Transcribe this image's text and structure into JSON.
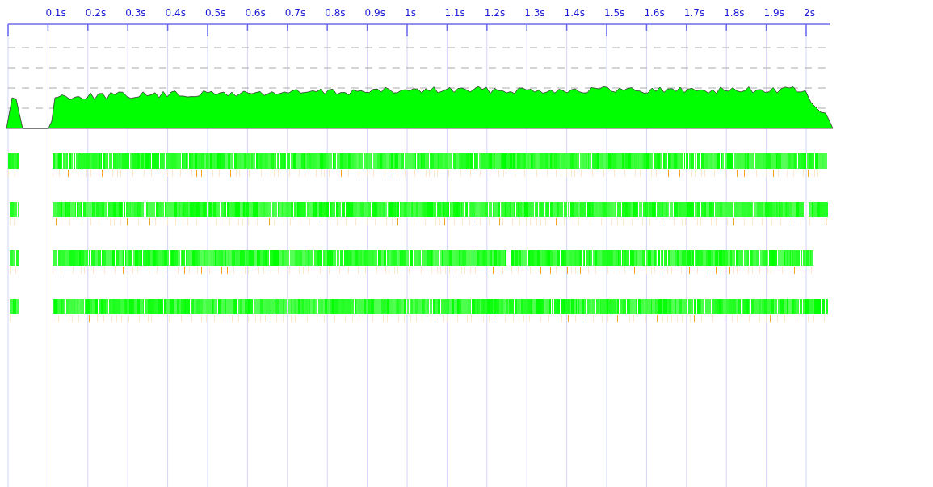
{
  "time_axis": {
    "ticks": [
      "0.1s",
      "0.2s",
      "0.3s",
      "0.4s",
      "0.5s",
      "0.6s",
      "0.7s",
      "0.8s",
      "0.9s",
      "1s",
      "1.1s",
      "1.2s",
      "1.3s",
      "1.4s",
      "1.5s",
      "1.6s",
      "1.7s",
      "1.8s",
      "1.9s",
      "2s"
    ]
  }
}
